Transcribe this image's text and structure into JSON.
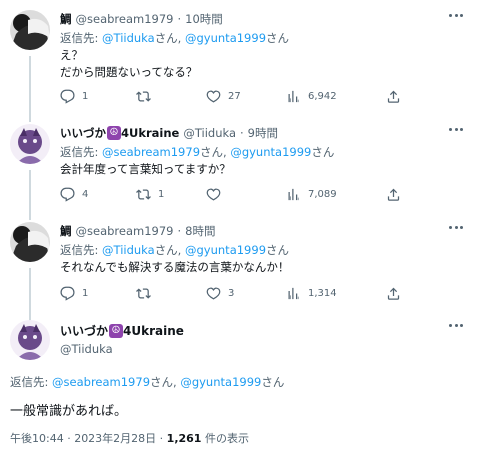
{
  "tweets": [
    {
      "name": "鯛",
      "handle": "@seabream1979",
      "dot": "·",
      "time": "10時間",
      "reply_label": "返信先: ",
      "reply_user1": "@Tiiduka",
      "reply_mid": "さん, ",
      "reply_user2": "@gyunta1999",
      "reply_end": "さん",
      "lines": [
        "え？",
        "だから問題ないってなる？"
      ],
      "replies": "1",
      "retweets": "",
      "likes": "27",
      "views": "6,942"
    },
    {
      "name": "いいづか",
      "name_suffix": "4Ukraine",
      "handle": "@Tiiduka",
      "dot": "·",
      "time": "9時間",
      "reply_label": "返信先: ",
      "reply_user1": "@seabream1979",
      "reply_mid": "さん, ",
      "reply_user2": "@gyunta1999",
      "reply_end": "さん",
      "lines": [
        "会計年度って言葉知ってますか？"
      ],
      "replies": "4",
      "retweets": "1",
      "likes": "",
      "views": "7,089"
    },
    {
      "name": "鯛",
      "handle": "@seabream1979",
      "dot": "·",
      "time": "8時間",
      "reply_label": "返信先: ",
      "reply_user1": "@Tiiduka",
      "reply_mid": "さん, ",
      "reply_user2": "@gyunta1999",
      "reply_end": "さん",
      "lines": [
        "それなんでも解決する魔法の言葉かなんか！"
      ],
      "replies": "1",
      "retweets": "",
      "likes": "3",
      "views": "1,314"
    }
  ],
  "main": {
    "name": "いいづか",
    "name_suffix": "4Ukraine",
    "handle": "@Tiiduka",
    "reply_label": "返信先: ",
    "reply_user1": "@seabream1979",
    "reply_mid": "さん, ",
    "reply_user2": "@gyunta1999",
    "reply_end": "さん",
    "text": "一般常識があれば。",
    "timestamp": "午後10:44 · 2023年2月28日 · ",
    "views_count": "1,261",
    "views_label": " 件の表示"
  },
  "colors": {
    "link": "#1d9bf0",
    "secondary": "#536471",
    "line": "#cfd9de",
    "peace_badge": "#8e44ad"
  },
  "icons": [
    "reply-icon",
    "retweet-icon",
    "like-icon",
    "views-icon",
    "share-icon",
    "more-icon",
    "peace-icon"
  ]
}
